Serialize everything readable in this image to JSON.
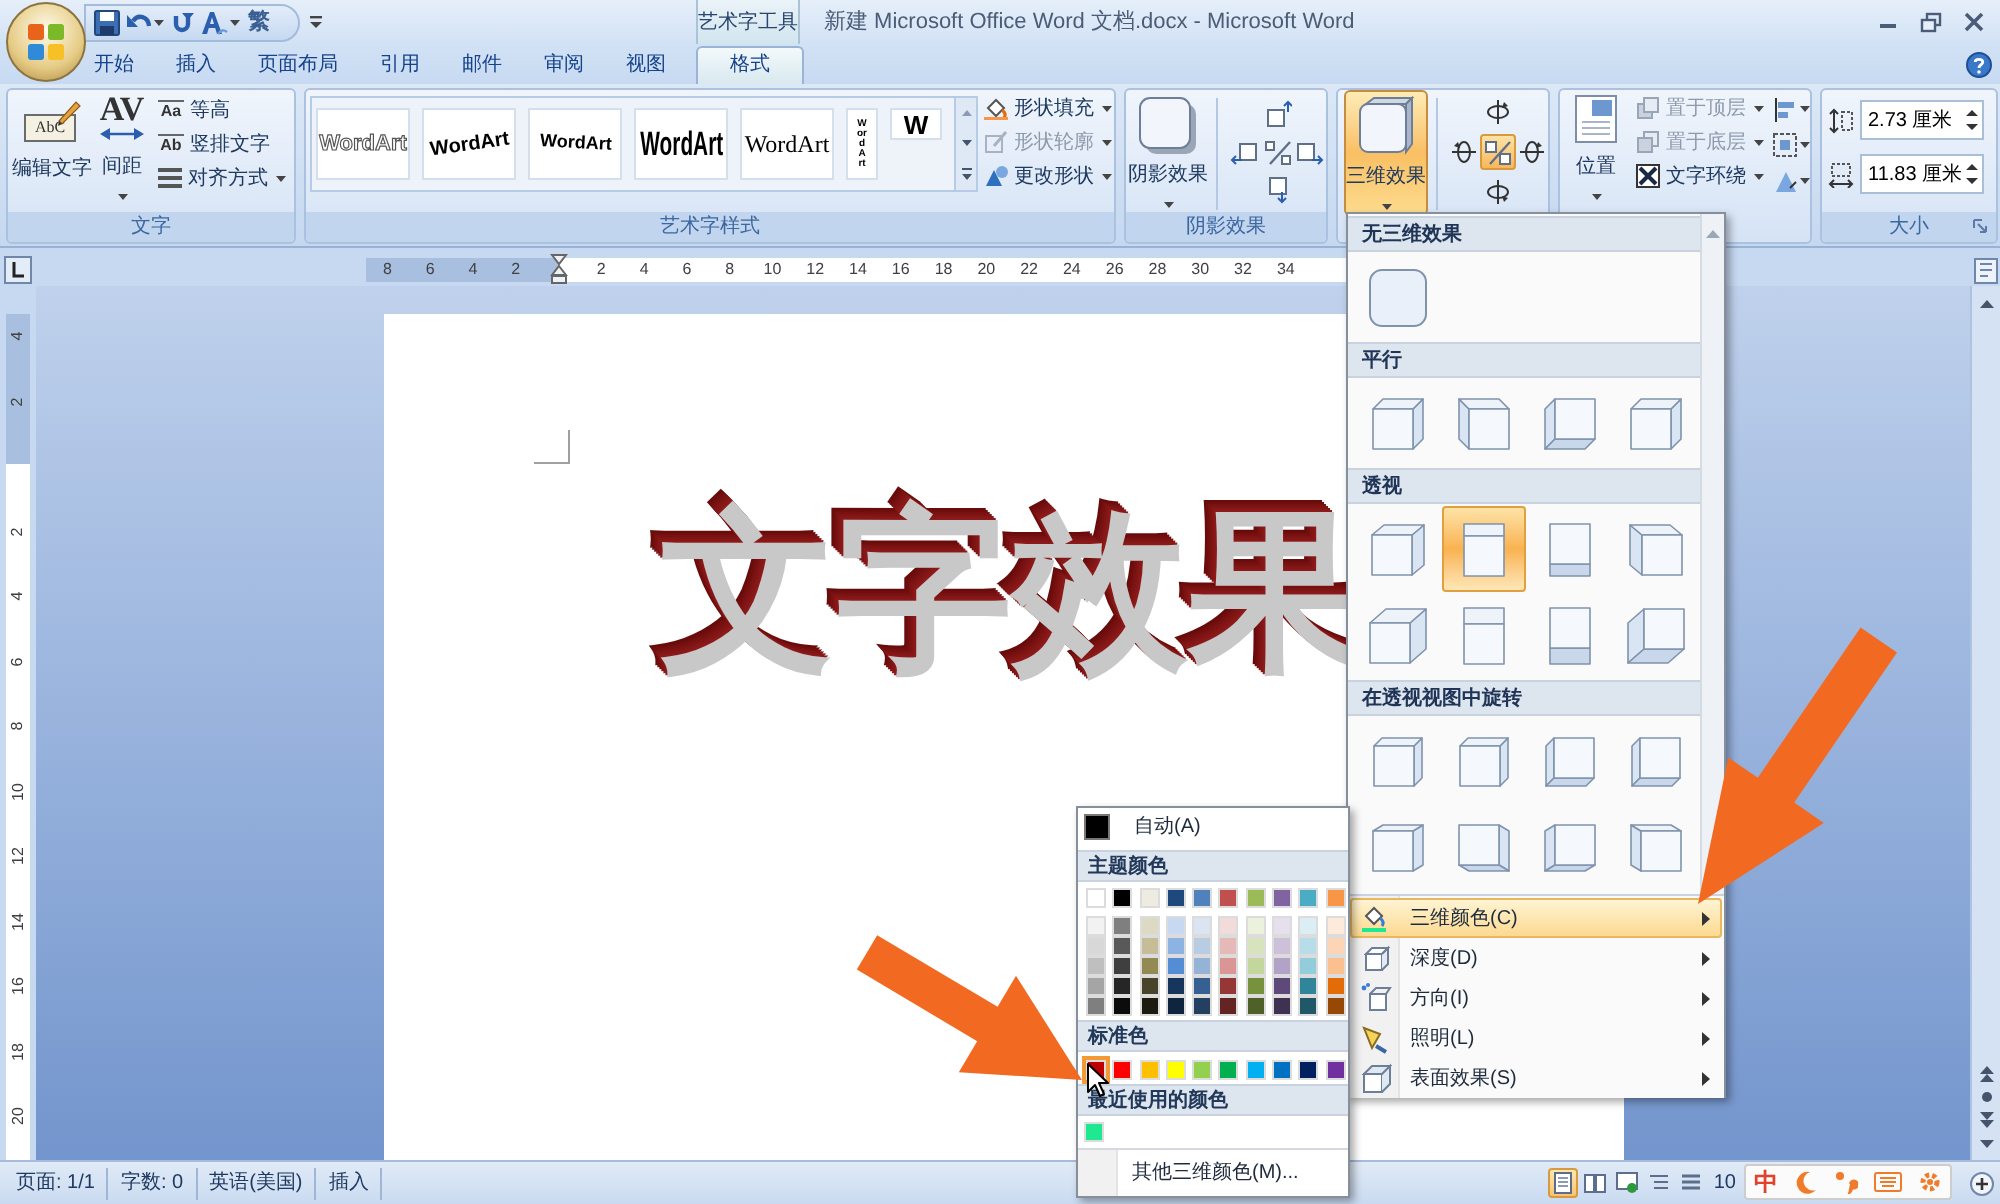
{
  "title_bar": {
    "quick_access": [
      {
        "kind": "save",
        "dropdown": false
      },
      {
        "kind": "undo",
        "dropdown": true
      },
      {
        "kind": "repeat",
        "dropdown": false
      },
      {
        "kind": "style",
        "dropdown": true
      },
      {
        "kind": "glyph",
        "label": "繁",
        "dropdown": false
      }
    ],
    "context_label": "艺术字工具",
    "title": "新建 Microsoft Office Word 文档.docx - Microsoft Word"
  },
  "tabs": [
    {
      "label": "开始",
      "selected": false
    },
    {
      "label": "插入",
      "selected": false
    },
    {
      "label": "页面布局",
      "selected": false
    },
    {
      "label": "引用",
      "selected": false
    },
    {
      "label": "邮件",
      "selected": false
    },
    {
      "label": "审阅",
      "selected": false
    },
    {
      "label": "视图",
      "selected": false
    },
    {
      "label": "格式",
      "selected": true
    }
  ],
  "ribbon": {
    "text_group": {
      "label": "文字",
      "edit_text": {
        "label": "编辑文字",
        "icon_text": "AbC"
      },
      "spacing": {
        "label": "间距",
        "icon_text": "AV"
      },
      "commands": [
        {
          "label": "等高",
          "icon_text": "Aa",
          "dropdown": false
        },
        {
          "label": "竖排文字",
          "icon_text": "Ab",
          "dropdown": false
        },
        {
          "label": "对齐方式",
          "dropdown": true
        }
      ]
    },
    "wordart_group": {
      "label": "艺术字样式",
      "styles": [
        {
          "kind": "outline",
          "text": "WordArt"
        },
        {
          "kind": "wave",
          "text": "WordArt"
        },
        {
          "kind": "arch",
          "text": "WordArt"
        },
        {
          "kind": "heavy",
          "text": "WordArt"
        },
        {
          "kind": "serif",
          "text": "WordArt"
        },
        {
          "kind": "vertical",
          "text": "WordArt"
        },
        {
          "kind": "boxed",
          "text": "W"
        }
      ],
      "commands": [
        {
          "label": "形状填充",
          "disabled": false
        },
        {
          "label": "形状轮廓",
          "disabled": true
        },
        {
          "label": "更改形状",
          "disabled": false
        }
      ]
    },
    "shadow_group": {
      "label": "阴影效果",
      "button": {
        "label": "阴影效果"
      }
    },
    "effects_group": {
      "button": {
        "label": "三维效果",
        "pressed": true
      },
      "toggle_on": true
    },
    "arrange_group": {
      "position": {
        "label": "位置"
      },
      "commands": [
        {
          "label": "置于顶层",
          "disabled": true
        },
        {
          "label": "置于底层",
          "disabled": true
        },
        {
          "label": "文字环绕",
          "disabled": false
        }
      ]
    },
    "size_group": {
      "label": "大小",
      "fields": [
        {
          "value": "2.73 厘米"
        },
        {
          "value": "11.83 厘米"
        }
      ]
    }
  },
  "ruler": {
    "left_labels": [
      "8",
      "6",
      "4",
      "2"
    ],
    "right_labels": [
      "2",
      "4",
      "6",
      "8",
      "10",
      "12",
      "14",
      "16",
      "18",
      "20",
      "22",
      "24",
      "26",
      "28",
      "30",
      "32",
      "34"
    ]
  },
  "vertical_ruler": {
    "top_labels": [
      "4",
      "2"
    ],
    "labels": [
      "2",
      "4",
      "6",
      "8",
      "10",
      "12",
      "14",
      "16",
      "18",
      "20"
    ]
  },
  "document": {
    "wordart": "文字效果"
  },
  "effects_menu": {
    "sections": [
      {
        "heading": "无三维效果",
        "items": [
          {
            "selected": false
          }
        ]
      },
      {
        "heading": "平行",
        "items": [
          {
            "selected": false
          },
          {
            "selected": false
          },
          {
            "selected": false
          },
          {
            "selected": false
          }
        ]
      },
      {
        "heading": "透视",
        "items": [
          {
            "selected": false
          },
          {
            "selected": true
          },
          {
            "selected": false
          },
          {
            "selected": false
          },
          {
            "selected": false
          },
          {
            "selected": false
          },
          {
            "selected": false
          },
          {
            "selected": false
          }
        ]
      },
      {
        "heading": "在透视视图中旋转",
        "items": [
          {
            "selected": false
          },
          {
            "selected": false
          },
          {
            "selected": false
          },
          {
            "selected": false
          },
          {
            "selected": false
          },
          {
            "selected": false
          },
          {
            "selected": false
          },
          {
            "selected": false
          }
        ]
      }
    ],
    "commands": [
      {
        "label": "三维颜色(C)",
        "selected": true
      },
      {
        "label": "深度(D)",
        "selected": false
      },
      {
        "label": "方向(I)",
        "selected": false
      },
      {
        "label": "照明(L)",
        "selected": false
      },
      {
        "label": "表面效果(S)",
        "selected": false
      }
    ]
  },
  "color_menu": {
    "automatic": {
      "label": "自动(A)",
      "color": "#000000"
    },
    "theme_heading": "主题颜色",
    "theme_colors": [
      {
        "color": "#ffffff"
      },
      {
        "color": "#000000"
      },
      {
        "color": "#eeece1"
      },
      {
        "color": "#1f497d"
      },
      {
        "color": "#4f81bd"
      },
      {
        "color": "#c0504d"
      },
      {
        "color": "#9bbb59"
      },
      {
        "color": "#8064a2"
      },
      {
        "color": "#4bacc6"
      },
      {
        "color": "#f79646"
      }
    ],
    "theme_shades": [
      [
        {
          "color": "#f2f2f2"
        },
        {
          "color": "#7f7f7f"
        },
        {
          "color": "#ddd9c3"
        },
        {
          "color": "#c6d9f0"
        },
        {
          "color": "#dbe5f1"
        },
        {
          "color": "#f2dcdb"
        },
        {
          "color": "#ebf1dd"
        },
        {
          "color": "#e5e0ec"
        },
        {
          "color": "#dbeef3"
        },
        {
          "color": "#fdeada"
        }
      ],
      [
        {
          "color": "#d8d8d8"
        },
        {
          "color": "#595959"
        },
        {
          "color": "#c4bd97"
        },
        {
          "color": "#8db3e2"
        },
        {
          "color": "#b8cce4"
        },
        {
          "color": "#e5b9b7"
        },
        {
          "color": "#d7e3bc"
        },
        {
          "color": "#ccc1d9"
        },
        {
          "color": "#b7dde8"
        },
        {
          "color": "#fbd5b5"
        }
      ],
      [
        {
          "color": "#bfbfbf"
        },
        {
          "color": "#3f3f3f"
        },
        {
          "color": "#938953"
        },
        {
          "color": "#548dd4"
        },
        {
          "color": "#95b3d7"
        },
        {
          "color": "#d99694"
        },
        {
          "color": "#c3d69b"
        },
        {
          "color": "#b2a2c7"
        },
        {
          "color": "#92cddc"
        },
        {
          "color": "#fac08f"
        }
      ],
      [
        {
          "color": "#a5a5a5"
        },
        {
          "color": "#262626"
        },
        {
          "color": "#494429"
        },
        {
          "color": "#17365d"
        },
        {
          "color": "#366092"
        },
        {
          "color": "#953734"
        },
        {
          "color": "#76923c"
        },
        {
          "color": "#5f497a"
        },
        {
          "color": "#31859b"
        },
        {
          "color": "#e36c09"
        }
      ],
      [
        {
          "color": "#7f7f7f"
        },
        {
          "color": "#0c0c0c"
        },
        {
          "color": "#1d1b10"
        },
        {
          "color": "#0f243e"
        },
        {
          "color": "#244061"
        },
        {
          "color": "#632423"
        },
        {
          "color": "#4f6128"
        },
        {
          "color": "#3f3151"
        },
        {
          "color": "#205867"
        },
        {
          "color": "#974806"
        }
      ]
    ],
    "standard_heading": "标准色",
    "standard_colors": [
      {
        "color": "#c00000",
        "selected": true
      },
      {
        "color": "#ff0000",
        "selected": false
      },
      {
        "color": "#ffc000",
        "selected": false
      },
      {
        "color": "#ffff00",
        "selected": false
      },
      {
        "color": "#92d050",
        "selected": false
      },
      {
        "color": "#00b050",
        "selected": false
      },
      {
        "color": "#00b0f0",
        "selected": false
      },
      {
        "color": "#0070c0",
        "selected": false
      },
      {
        "color": "#002060",
        "selected": false
      },
      {
        "color": "#7030a0",
        "selected": false
      }
    ],
    "recent_heading": "最近使用的颜色",
    "recent_colors": [
      {
        "color": "#1ee890"
      }
    ],
    "more_label": "其他三维颜色(M)..."
  },
  "status_bar": {
    "items": [
      "页面: 1/1",
      "字数: 0",
      "英语(美国)",
      "插入"
    ],
    "views": [
      {
        "selected": true
      },
      {
        "selected": false
      },
      {
        "selected": false
      },
      {
        "selected": false
      },
      {
        "selected": false
      }
    ],
    "zoom": "10"
  },
  "ime_bar": {
    "mode": "中"
  }
}
